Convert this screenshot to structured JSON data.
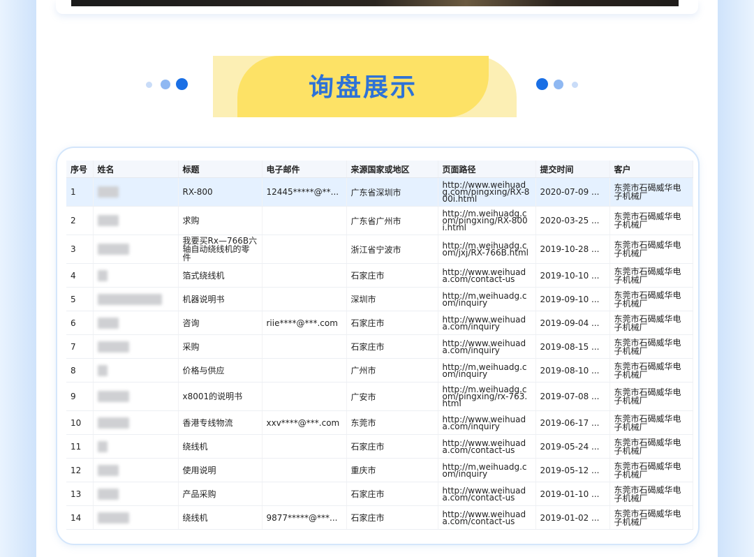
{
  "section": {
    "title": "询盘展示"
  },
  "theme": {
    "accent": "#2e72d6",
    "banner_yellow": "#fde266",
    "dot_dark": "#1a6fe5",
    "dot_mid": "#8fb8f2",
    "dot_light": "#c9dcf8"
  },
  "table": {
    "columns": [
      "序号",
      "姓名",
      "标题",
      "电子邮件",
      "来源国家或地区",
      "页面路径",
      "提交时间",
      "客户"
    ],
    "rows": [
      {
        "no": "1",
        "name_blur": 30,
        "title": "RX-800",
        "email": "12445*****@**...",
        "region": "广东省深圳市",
        "path": "http://www.weihuadg.com/pingxing/RX-800i.html",
        "time": "2020-07-09 ...",
        "client": "东莞市石碣威华电子机械厂"
      },
      {
        "no": "2",
        "name_blur": 30,
        "title": "求购",
        "email": "",
        "region": "广东省广州市",
        "path": "http://m.weihuadg.com/pingxing/RX-800i.html",
        "time": "2020-03-25 ...",
        "client": "东莞市石碣威华电子机械厂"
      },
      {
        "no": "3",
        "name_blur": 45,
        "title": "我要买Rx—766B六轴自动绕线机的零件",
        "email": "",
        "region": "浙江省宁波市",
        "path": "http://m.weihuadg.com/jxj/RX-766B.html",
        "time": "2019-10-28 ...",
        "client": "东莞市石碣威华电子机械厂"
      },
      {
        "no": "4",
        "name_blur": 14,
        "title": "箔式绕线机",
        "email": "",
        "region": "石家庄市",
        "path": "http://www.weihuada.com/contact-us",
        "time": "2019-10-10 ...",
        "client": "东莞市石碣威华电子机械厂"
      },
      {
        "no": "5",
        "name_blur": 92,
        "title": "机器说明书",
        "email": "",
        "region": "深圳市",
        "path": "http://m.weihuadg.com/inquiry",
        "time": "2019-09-10 ...",
        "client": "东莞市石碣威华电子机械厂"
      },
      {
        "no": "6",
        "name_blur": 30,
        "title": "咨询",
        "email": "riie****@***.com",
        "region": "石家庄市",
        "path": "http://www.weihuada.com/inquiry",
        "time": "2019-09-04 ...",
        "client": "东莞市石碣威华电子机械厂"
      },
      {
        "no": "7",
        "name_blur": 45,
        "title": "采购",
        "email": "",
        "region": "石家庄市",
        "path": "http://www.weihuada.com/inquiry",
        "time": "2019-08-15 ...",
        "client": "东莞市石碣威华电子机械厂"
      },
      {
        "no": "8",
        "name_blur": 14,
        "title": "价格与供应",
        "email": "",
        "region": "广州市",
        "path": "http://m.weihuadg.com/inquiry",
        "time": "2019-08-10 ...",
        "client": "东莞市石碣威华电子机械厂"
      },
      {
        "no": "9",
        "name_blur": 45,
        "title": "x8001的说明书",
        "email": "",
        "region": "广安市",
        "path": "http://m.weihuadg.com/pingxing/rx-763.html",
        "time": "2019-07-08 ...",
        "client": "东莞市石碣威华电子机械厂"
      },
      {
        "no": "10",
        "name_blur": 45,
        "title": "香港专线物流",
        "email": "xxv****@***.com",
        "region": "东莞市",
        "path": "http://www.weihuada.com/inquiry",
        "time": "2019-06-17 ...",
        "client": "东莞市石碣威华电子机械厂"
      },
      {
        "no": "11",
        "name_blur": 14,
        "title": "绕线机",
        "email": "",
        "region": "石家庄市",
        "path": "http://www.weihuada.com/contact-us",
        "time": "2019-05-24 ...",
        "client": "东莞市石碣威华电子机械厂"
      },
      {
        "no": "12",
        "name_blur": 30,
        "title": "使用说明",
        "email": "",
        "region": "重庆市",
        "path": "http://m.weihuadg.com/inquiry",
        "time": "2019-05-12 ...",
        "client": "东莞市石碣威华电子机械厂"
      },
      {
        "no": "13",
        "name_blur": 30,
        "title": "产品采购",
        "email": "",
        "region": "石家庄市",
        "path": "http://www.weihuada.com/contact-us",
        "time": "2019-01-10 ...",
        "client": "东莞市石碣威华电子机械厂"
      },
      {
        "no": "14",
        "name_blur": 45,
        "title": "绕线机",
        "email": "9877*****@***...",
        "region": "石家庄市",
        "path": "http://www.weihuada.com/contact-us",
        "time": "2019-01-02 ...",
        "client": "东莞市石碣威华电子机械厂"
      }
    ]
  }
}
